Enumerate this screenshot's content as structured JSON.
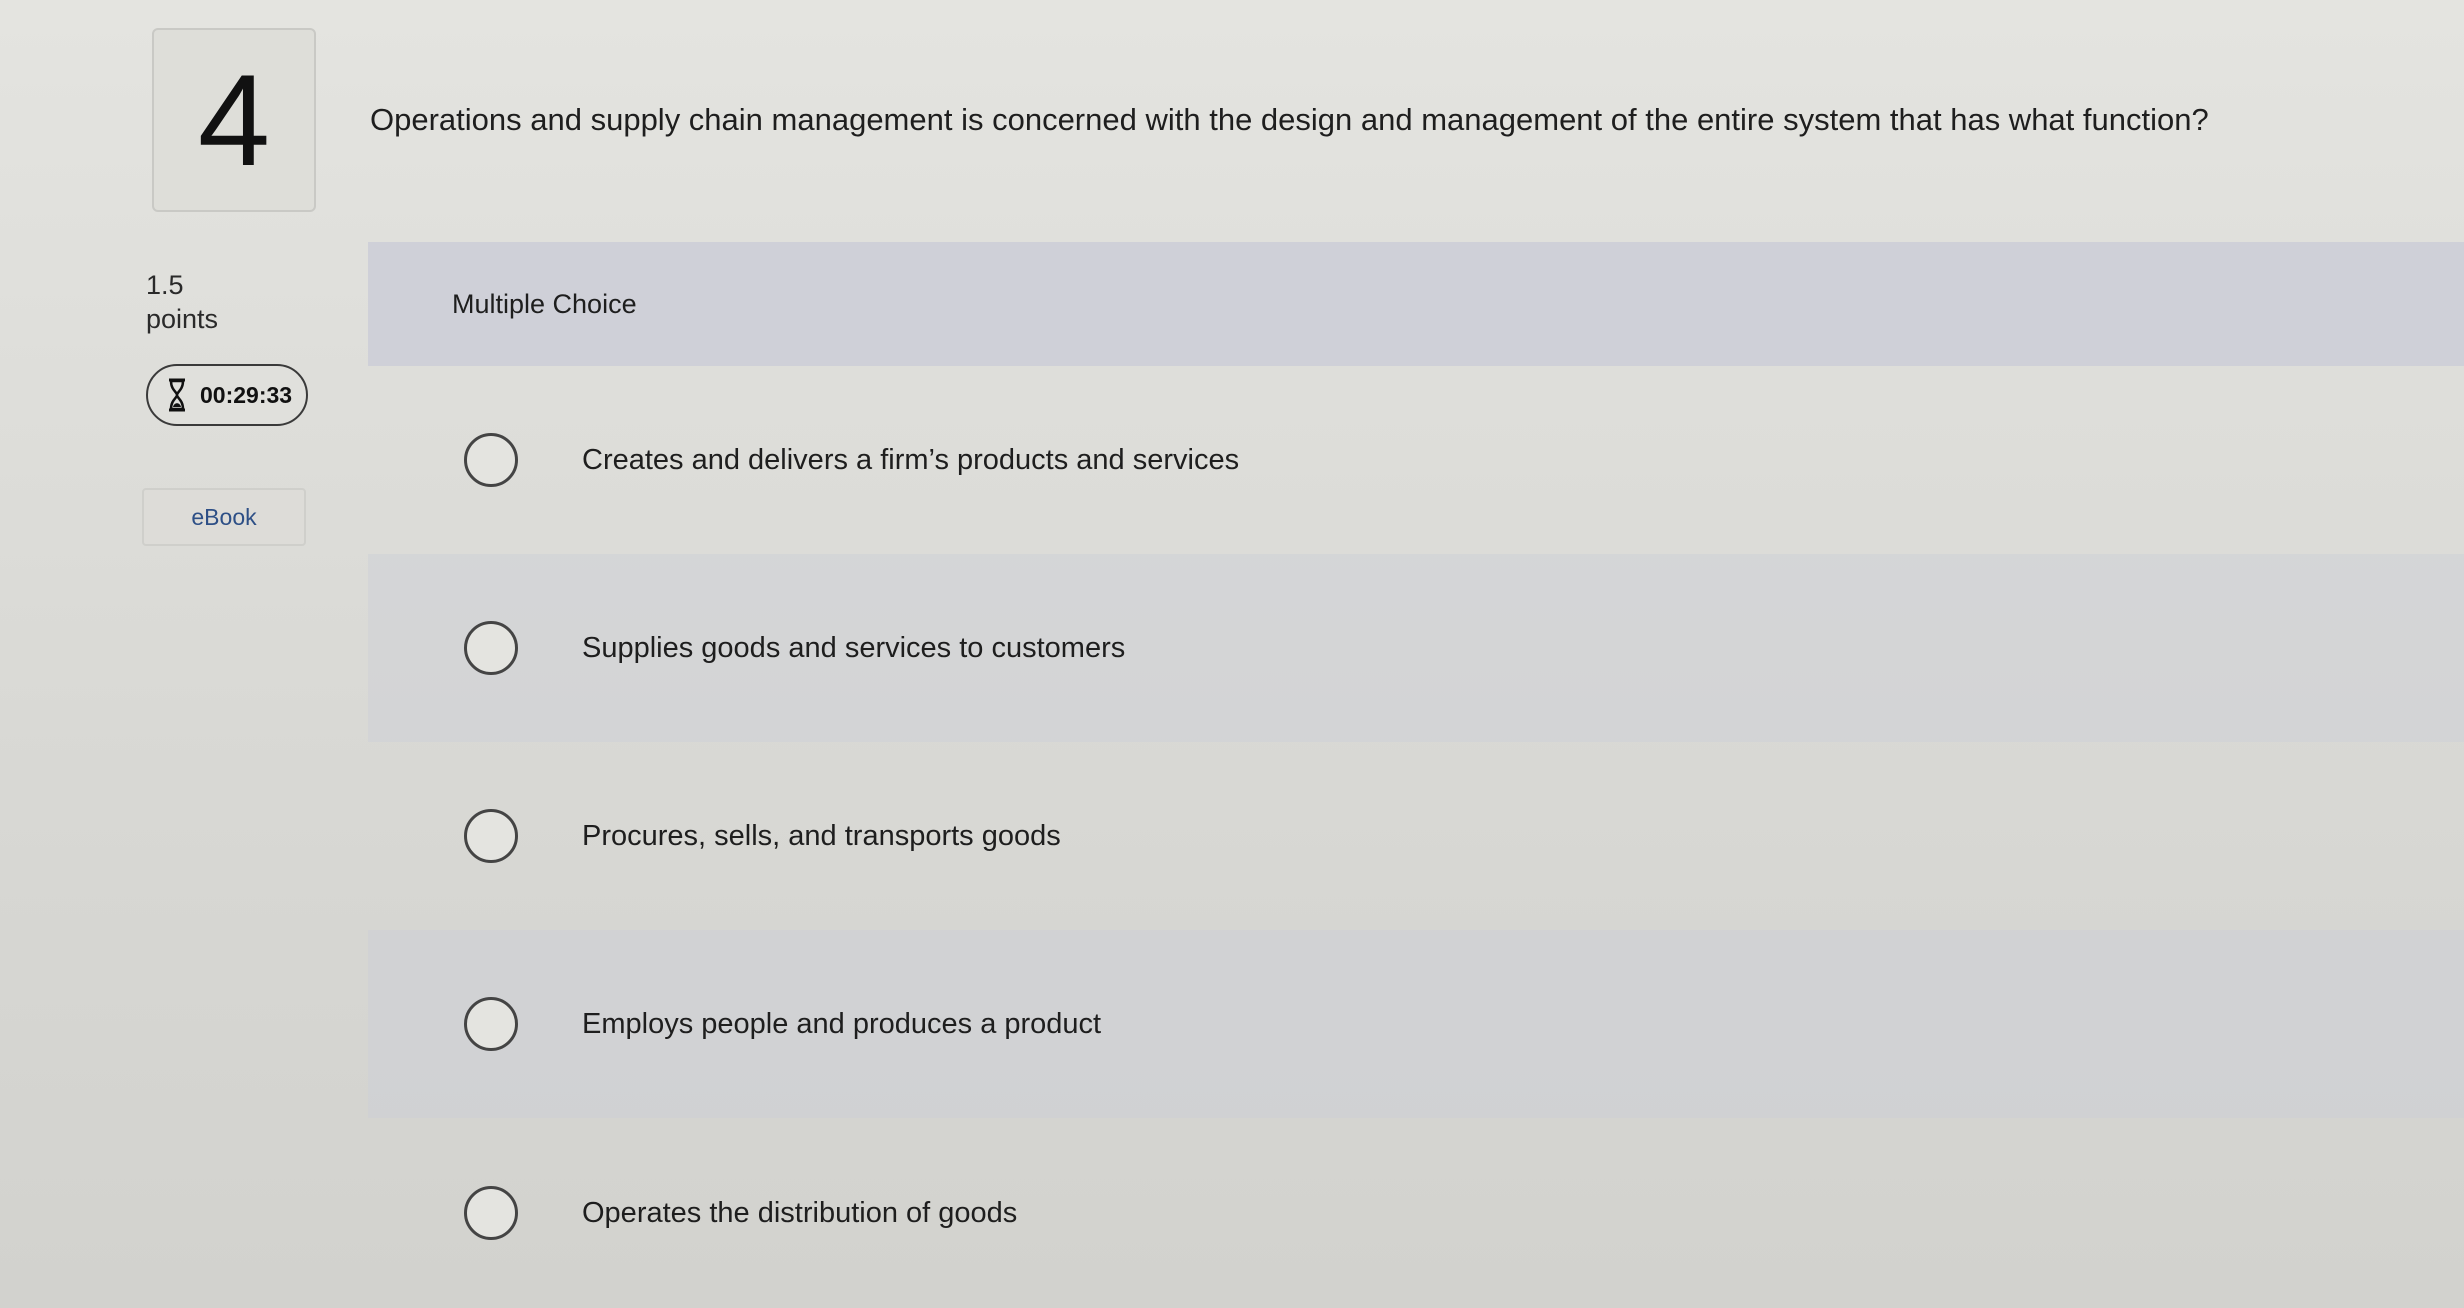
{
  "question": {
    "number": "4",
    "text": "Operations and supply chain management is concerned with the design and management of the entire system that has what function?",
    "points_value": "1.5",
    "points_label": "points",
    "timer": "00:29:33",
    "ebook_label": "eBook"
  },
  "answer_area": {
    "type_label": "Multiple Choice",
    "choices": [
      {
        "label": "Creates and delivers a firm’s products and services",
        "selected": false
      },
      {
        "label": "Supplies goods and services to customers",
        "selected": false
      },
      {
        "label": "Procures, sells, and transports goods",
        "selected": false
      },
      {
        "label": "Employs people and produces a product",
        "selected": false
      },
      {
        "label": "Operates the distribution of goods",
        "selected": false
      }
    ]
  },
  "icons": {
    "timer": "hourglass-icon"
  }
}
